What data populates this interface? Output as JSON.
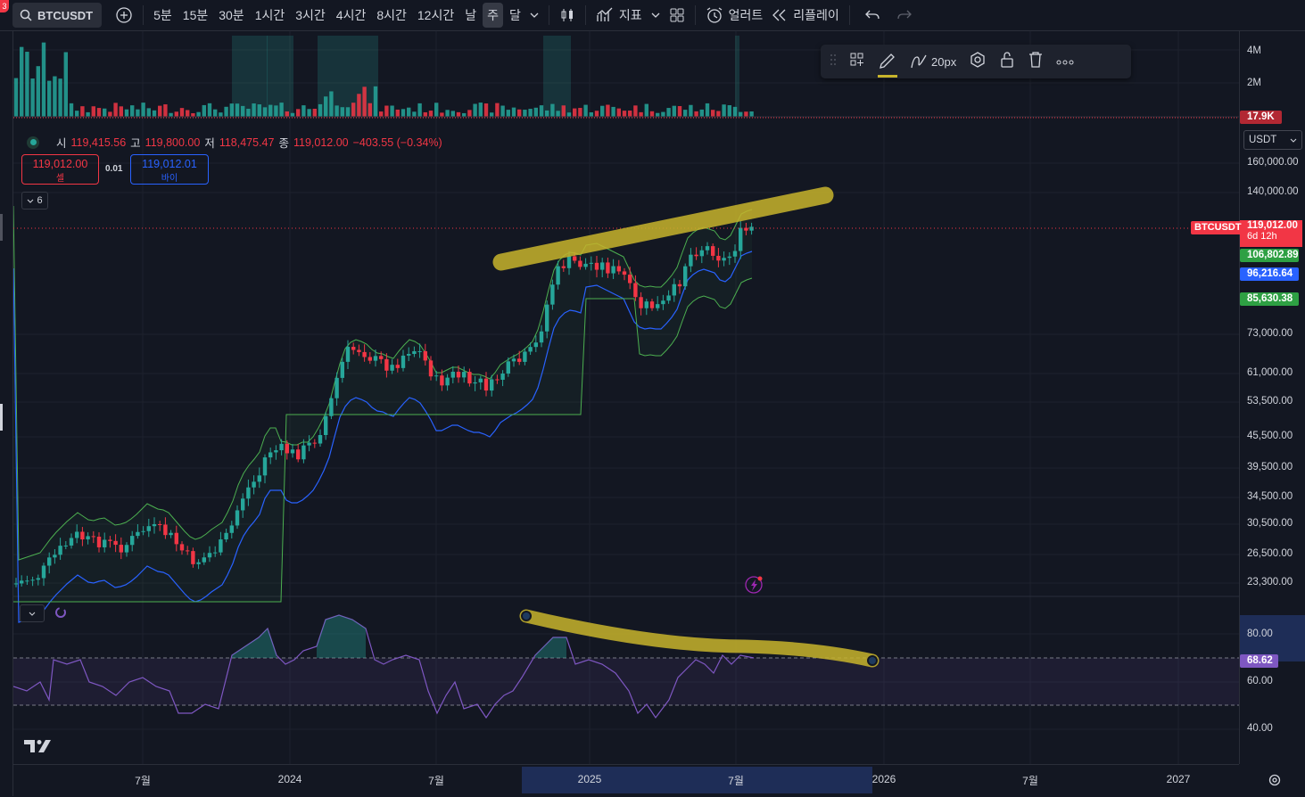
{
  "toolbar": {
    "notification_count": "3",
    "symbol": "BTCUSDT",
    "intervals": [
      "5분",
      "15분",
      "30분",
      "1시간",
      "3시간",
      "4시간",
      "8시간",
      "12시간",
      "날",
      "주",
      "달"
    ],
    "active_interval": "주",
    "indicators_label": "지표",
    "alert_label": "얼러트",
    "replay_label": "리플레이"
  },
  "legend": {
    "open_label": "시",
    "open": "119,415.56",
    "high_label": "고",
    "high": "119,800.00",
    "low_label": "저",
    "low": "118,475.47",
    "close_label": "종",
    "close": "119,012.00",
    "change": "−403.55 (−0.34%)"
  },
  "trade": {
    "sell_price": "119,012.00",
    "sell_label": "셀",
    "spread": "0.01",
    "buy_price": "119,012.01",
    "buy_label": "바이"
  },
  "collapse_count": "6",
  "drawing_toolbar": {
    "width_label": "20px"
  },
  "price_axis": {
    "currency": "USDT",
    "labels": [
      "160,000.00",
      "140,000.00",
      "73,000.00",
      "61,000.00",
      "53,500.00",
      "45,500.00",
      "39,500.00",
      "34,500.00",
      "30,500.00",
      "26,500.00",
      "23,300.00"
    ],
    "volume_labels": [
      "4M",
      "2M"
    ],
    "volume_current": "17.9K",
    "symbol_tag": "BTCUSDT",
    "last_price": "119,012.00",
    "countdown": "6d 12h",
    "band_upper": "106,802.89",
    "band_mid": "96,216.64",
    "band_lower": "85,630.38",
    "rsi_labels": [
      "80.00",
      "60.00",
      "40.00"
    ],
    "rsi_current": "68.62"
  },
  "time_axis": {
    "labels": [
      "7월",
      "2024",
      "7월",
      "2025",
      "7월",
      "2026",
      "7월",
      "2027"
    ]
  },
  "colors": {
    "up": "#26a69a",
    "down": "#f23645",
    "band_upper": "#4caf50",
    "band_mid": "#2962ff",
    "rsi": "#7e57c2",
    "highlight": "#c8b42b",
    "background": "#131722"
  }
}
